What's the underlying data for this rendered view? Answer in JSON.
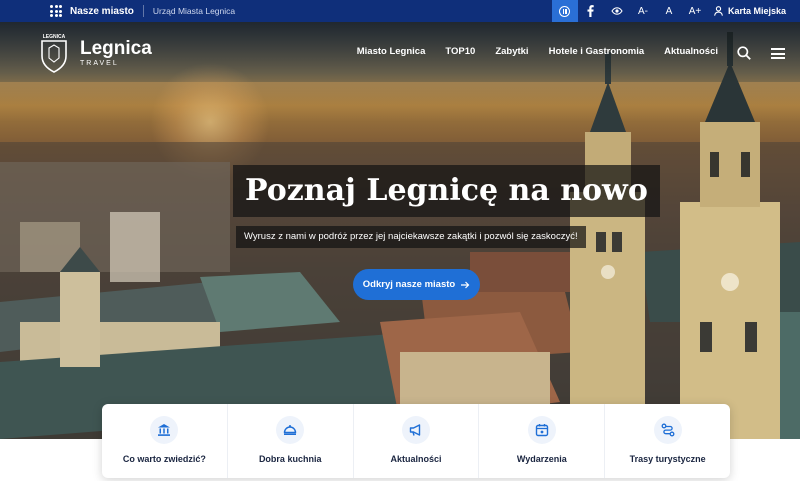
{
  "topbar": {
    "city_menu": "Nasze miasto",
    "office_link": "Urząd Miasta Legnica",
    "font_decrease": "A-",
    "font_normal": "A",
    "font_increase": "A+",
    "city_card": "Karta Miejska"
  },
  "logo": {
    "name": "Legnica",
    "sub": "TRAVEL",
    "crest_text": "LEGNICA"
  },
  "nav": {
    "items": [
      {
        "label": "Miasto Legnica"
      },
      {
        "label": "TOP10"
      },
      {
        "label": "Zabytki"
      },
      {
        "label": "Hotele i Gastronomia"
      },
      {
        "label": "Aktualności"
      }
    ]
  },
  "hero": {
    "title": "Poznaj Legnicę na nowo",
    "subtitle": "Wyrusz z nami w podróż przez jej najciekawsze zakątki i pozwól się zaskoczyć!",
    "cta": "Odkryj nasze miasto"
  },
  "quick_links": [
    {
      "label": "Co warto zwiedzić?",
      "icon": "monument-icon"
    },
    {
      "label": "Dobra kuchnia",
      "icon": "dish-icon"
    },
    {
      "label": "Aktualności",
      "icon": "megaphone-icon"
    },
    {
      "label": "Wydarzenia",
      "icon": "calendar-icon"
    },
    {
      "label": "Trasy turystyczne",
      "icon": "route-icon"
    }
  ],
  "colors": {
    "topbar": "#0f2f7a",
    "accent": "#1f6fd6",
    "active_toggle": "#2a6fd6"
  }
}
